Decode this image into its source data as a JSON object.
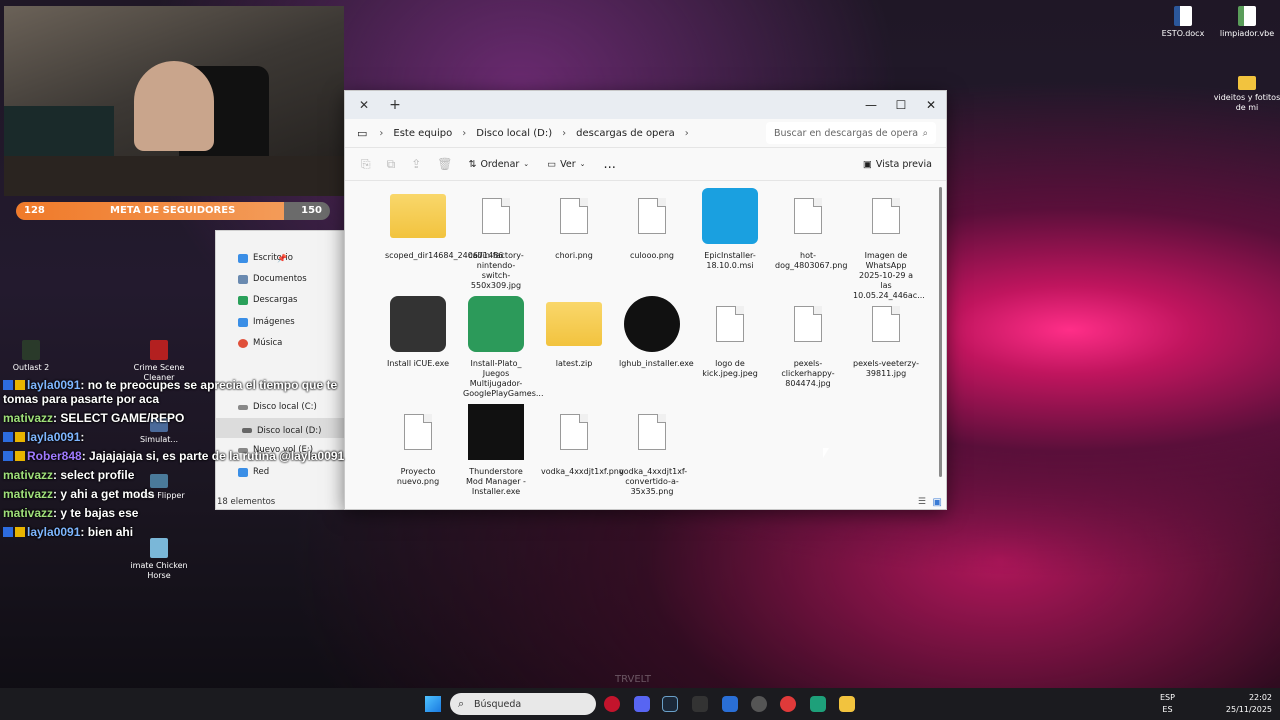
{
  "desktop": {
    "icons": [
      {
        "label": "ESTO.docx",
        "color": "#2b579a"
      },
      {
        "label": "limpiador.vbe",
        "color": "#5a9d5a"
      },
      {
        "label": "videitos y fotitos de mi",
        "color": "#f2c33e"
      },
      {
        "label": "Outlast 2",
        "color": "#3a5a3a"
      },
      {
        "label": "Crime Scene Cleaner",
        "color": "#b32020"
      },
      {
        "label": "Simulat...",
        "color": "#4a6a9a"
      },
      {
        "label": "louse Flipper",
        "color": "#4a7a9a"
      },
      {
        "label": "imate Chicken Horse",
        "color": "#7ab7d8"
      }
    ]
  },
  "stream": {
    "follower_goal": {
      "label": "META DE SEGUIDORES",
      "current": "128",
      "target": "150",
      "progress": 0.853
    }
  },
  "chat": [
    {
      "user": "layla0091",
      "text": ": no te preocupes se aprecia el tiempo que te tomas para pasarte por aca",
      "user_color": "#7eb6ff"
    },
    {
      "user": "mativazz",
      "text": ": SELECT GAME/REPO",
      "user_color": "#9fe07a"
    },
    {
      "user": "layla0091",
      "text": ":",
      "user_color": "#7eb6ff"
    },
    {
      "user": "Rober848",
      "text": ": Jajajajaja si, es parte de la rutina @layla0091",
      "user_color": "#a07aff"
    },
    {
      "user": "mativazz",
      "text": ": select profile",
      "user_color": "#9fe07a"
    },
    {
      "user": "mativazz",
      "text": ": y ahi a get mods",
      "user_color": "#9fe07a"
    },
    {
      "user": "mativazz",
      "text": ": y te bajas ese",
      "user_color": "#9fe07a"
    },
    {
      "user": "layla0091",
      "text": ": bien ahi",
      "user_color": "#7eb6ff"
    }
  ],
  "explorer": {
    "breadcrumb": [
      "Este equipo",
      "Disco local (D:)",
      "descargas de opera"
    ],
    "search_placeholder": "Buscar en descargas de opera",
    "toolbar": {
      "sort": "Ordenar",
      "view": "Ver",
      "more": "...",
      "preview": "Vista previa"
    },
    "nav": [
      {
        "label": "Escritorio"
      },
      {
        "label": "Documentos"
      },
      {
        "label": "Descargas"
      },
      {
        "label": "Imágenes"
      },
      {
        "label": "Música"
      },
      {
        "label": "Disco local (C:)"
      },
      {
        "label": "Disco local (D:)"
      },
      {
        "label": "Nuevo vol (E:)"
      },
      {
        "label": "Red"
      }
    ],
    "files": [
      {
        "name": "scoped_dir14684_240671486",
        "type": "folder"
      },
      {
        "name": "cabin-factory-nintendo-switch-550x309.jpg",
        "type": "doc"
      },
      {
        "name": "chori.png",
        "type": "doc"
      },
      {
        "name": "culooo.png",
        "type": "doc"
      },
      {
        "name": "EpicInstaller-18.10.0.msi",
        "type": "epic"
      },
      {
        "name": "hot-dog_4803067.png",
        "type": "doc"
      },
      {
        "name": "Imagen de WhatsApp 2025-10-29 a las 10.05.24_446ac...",
        "type": "doc"
      },
      {
        "name": "Install iCUE.exe",
        "type": "icue"
      },
      {
        "name": "Install-Plato_ Juegos Multijugador-GooglePlayGames...",
        "type": "gpg"
      },
      {
        "name": "latest.zip",
        "type": "zip"
      },
      {
        "name": "lghub_installer.exe",
        "type": "lg"
      },
      {
        "name": "logo de kick.jpeg.jpeg",
        "type": "doc"
      },
      {
        "name": "pexels-clickerhappy-804474.jpg",
        "type": "doc"
      },
      {
        "name": "pexels-veeterzy-39811.jpg",
        "type": "doc"
      },
      {
        "name": "Proyecto nuevo.png",
        "type": "doc"
      },
      {
        "name": "Thunderstore Mod Manager - Installer.exe",
        "type": "ts"
      },
      {
        "name": "vodka_4xxdjt1xf.png",
        "type": "doc"
      },
      {
        "name": "vodka_4xxdjt1xf-convertido-a-35x35.png",
        "type": "doc"
      }
    ],
    "status": "18 elementos"
  },
  "taskbar": {
    "search_placeholder": "Búsqueda",
    "lang": "ESP",
    "lang2": "ES",
    "time": "22:02",
    "date": "25/11/2025",
    "watermark": "TRVELT"
  }
}
